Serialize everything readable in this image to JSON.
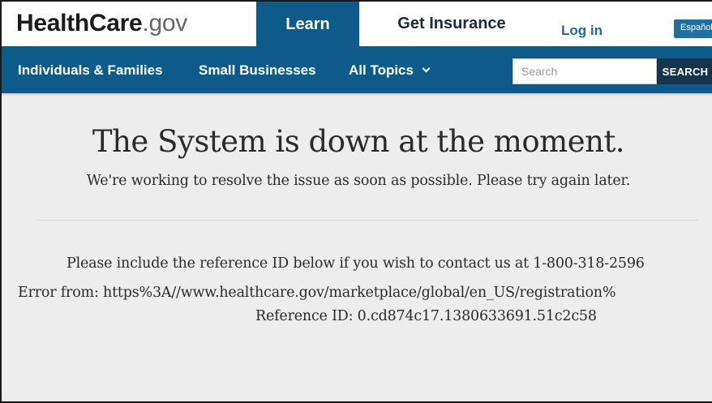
{
  "header": {
    "logo": {
      "part1": "Health",
      "part2": "Care",
      "part3": ".gov"
    },
    "tabs": [
      {
        "label": "Learn",
        "active": true
      },
      {
        "label": "Get Insurance",
        "active": false
      }
    ],
    "login_label": "Log in",
    "language_label": "Español"
  },
  "nav": {
    "items": [
      {
        "label": "Individuals & Families"
      },
      {
        "label": "Small Businesses"
      },
      {
        "label": "All Topics",
        "icon": "chevron-down-icon"
      }
    ],
    "search": {
      "placeholder": "Search",
      "value": "",
      "button_label": "SEARCH"
    }
  },
  "message": {
    "headline": "The System is down at the moment.",
    "subline": "We're working to resolve the issue as soon as possible. Please try again later.",
    "contact": "Please include the reference ID below if you wish to contact us at 1-800-318-2596",
    "error": "Error from: https%3A//www.healthcare.gov/marketplace/global/en_US/registration%",
    "reference": "Reference ID: 0.cd874c17.1380633691.51c2c58"
  },
  "colors": {
    "brand_blue": "#0d5b8a",
    "search_button": "#16344a",
    "link_blue": "#1a69a8",
    "page_background": "#ededed"
  }
}
